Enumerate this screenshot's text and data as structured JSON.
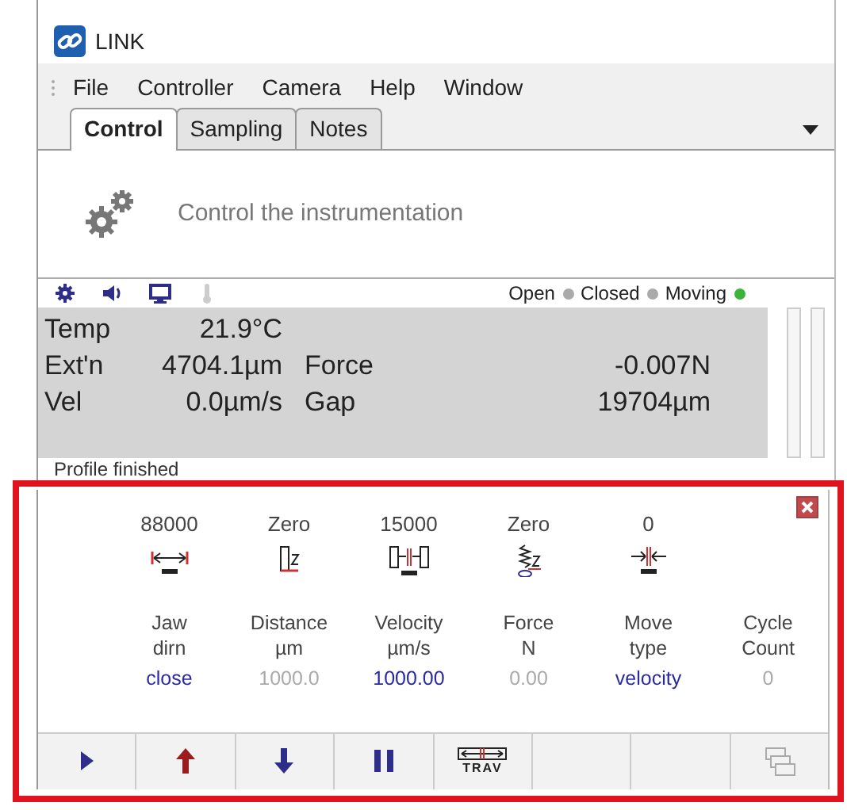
{
  "window": {
    "title": "LINK"
  },
  "menu": [
    "File",
    "Controller",
    "Camera",
    "Help",
    "Window"
  ],
  "tabs": [
    {
      "label": "Control",
      "selected": true
    },
    {
      "label": "Sampling",
      "selected": false
    },
    {
      "label": "Notes",
      "selected": false
    }
  ],
  "header": {
    "text": "Control the instrumentation"
  },
  "status_icons": [
    {
      "kind": "gear",
      "disabled": false
    },
    {
      "kind": "speaker",
      "disabled": false
    },
    {
      "kind": "monitor",
      "disabled": false
    },
    {
      "kind": "thermometer",
      "disabled": true
    }
  ],
  "indicators": [
    {
      "label": "Open",
      "on": false
    },
    {
      "label": "Closed",
      "on": false
    },
    {
      "label": "Moving",
      "on": true
    }
  ],
  "readouts": [
    {
      "label": "Temp",
      "value": "21.9°C"
    },
    {
      "label": "Ext'n",
      "value": "4704.1µm"
    },
    {
      "label": "Force",
      "value": "-0.007N"
    },
    {
      "label": "Vel",
      "value": "0.0µm/s"
    },
    {
      "label": "Gap",
      "value": "19704µm"
    }
  ],
  "message": "Profile finished",
  "parameters": [
    {
      "setting": "88000",
      "kind": "limit",
      "label": "Jaw\ndirn",
      "value": "close",
      "disabled": false
    },
    {
      "setting": "Zero",
      "kind": "zero-position",
      "label": "Distance\nµm",
      "value": "1000.0",
      "disabled": true
    },
    {
      "setting": "15000",
      "kind": "gap",
      "label": "Velocity\nµm/s",
      "value": "1000.00",
      "disabled": false
    },
    {
      "setting": "Zero",
      "kind": "zero-force",
      "label": "Force\nN",
      "value": "0.00",
      "disabled": true
    },
    {
      "setting": "0",
      "kind": "limit-in",
      "label": "Move\ntype",
      "value": "velocity",
      "disabled": false
    },
    {
      "label": "Cycle\nCount",
      "value": "0",
      "disabled": true
    }
  ],
  "toolbar": [
    {
      "kind": "play",
      "disabled": false
    },
    {
      "kind": "up",
      "disabled": false
    },
    {
      "kind": "down",
      "disabled": false
    },
    {
      "kind": "pause",
      "disabled": false
    },
    {
      "kind": "traverse",
      "label": "TRAV",
      "disabled": false
    },
    {
      "kind": "blank"
    },
    {
      "kind": "blank"
    },
    {
      "kind": "windows",
      "disabled": true
    }
  ]
}
